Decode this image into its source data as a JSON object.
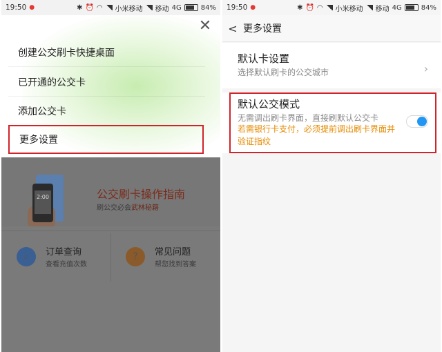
{
  "status": {
    "time": "19:50",
    "carrier1": "小米移动",
    "carrier2": "移动",
    "network": "4G",
    "battery": "84%",
    "battery_level": 0.84
  },
  "left": {
    "menu": {
      "items": [
        "创建公交刷卡快捷桌面",
        "已开通的公交卡",
        "添加公交卡",
        "更多设置"
      ],
      "close_icon": "close-icon"
    },
    "banner": {
      "title": "公交刷卡操作指南",
      "subtitle_prefix": "刷公交必会",
      "subtitle_highlight": "武林秘籍",
      "screen_time": "2:00"
    },
    "quick": [
      {
        "title": "订单查询",
        "subtitle": "查看充值次数",
        "icon": "search-icon",
        "color": "#3a5f93"
      },
      {
        "title": "常见问题",
        "subtitle": "帮您找到答案",
        "icon": "question-icon",
        "color": "#8a5a2a"
      }
    ]
  },
  "right": {
    "title": "更多设置",
    "default_card": {
      "label": "默认卡设置",
      "desc": "选择默认刷卡的公交城市"
    },
    "default_mode": {
      "label": "默认公交模式",
      "desc": "无需调出刷卡界面，直接刷默认公交卡",
      "warning": "若需银行卡支付，必须提前调出刷卡界面并验证指纹",
      "enabled": true
    }
  },
  "colors": {
    "accent": "#2196f3",
    "highlight_border": "#d0232a",
    "warning": "#e58a00"
  }
}
